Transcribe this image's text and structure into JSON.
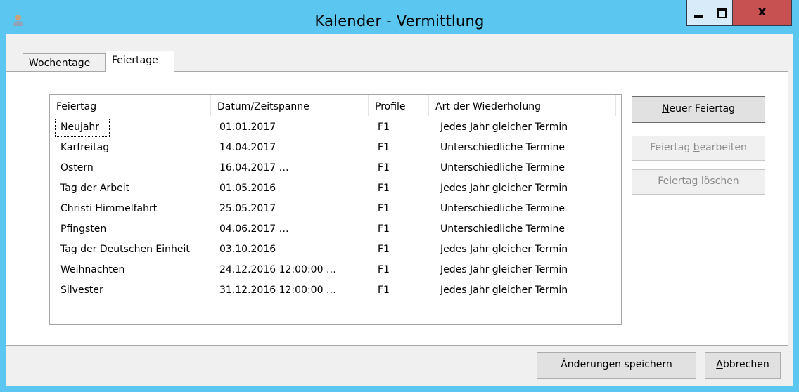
{
  "window": {
    "title": "Kalender - Vermittlung",
    "close_glyph": "x"
  },
  "tabs": [
    {
      "label": "Wochentage",
      "selected": false
    },
    {
      "label": "Feiertage",
      "selected": true
    }
  ],
  "list": {
    "columns": [
      "Feiertag",
      "Datum/Zeitspanne",
      "Profile",
      "Art der Wiederholung"
    ],
    "rows": [
      {
        "name": "Neujahr",
        "date": "01.01.2017",
        "profile": "F1",
        "repeat": "Jedes Jahr gleicher Termin"
      },
      {
        "name": "Karfreitag",
        "date": "14.04.2017",
        "profile": "F1",
        "repeat": "Unterschiedliche Termine"
      },
      {
        "name": "Ostern",
        "date": "16.04.2017 …",
        "profile": "F1",
        "repeat": "Unterschiedliche Termine"
      },
      {
        "name": "Tag der Arbeit",
        "date": "01.05.2016",
        "profile": "F1",
        "repeat": "Jedes Jahr gleicher Termin"
      },
      {
        "name": "Christi Himmelfahrt",
        "date": "25.05.2017",
        "profile": "F1",
        "repeat": "Unterschiedliche Termine"
      },
      {
        "name": "Pfingsten",
        "date": "04.06.2017 …",
        "profile": "F1",
        "repeat": "Unterschiedliche Termine"
      },
      {
        "name": "Tag der Deutschen Einheit",
        "date": "03.10.2016",
        "profile": "F1",
        "repeat": "Jedes Jahr gleicher Termin"
      },
      {
        "name": "Weihnachten",
        "date": "24.12.2016 12:00:00 …",
        "profile": "F1",
        "repeat": "Jedes Jahr gleicher Termin"
      },
      {
        "name": "Silvester",
        "date": "31.12.2016 12:00:00 …",
        "profile": "F1",
        "repeat": "Jedes Jahr gleicher Termin"
      }
    ]
  },
  "side_buttons": {
    "new": {
      "pre": "",
      "accel": "N",
      "post": "euer Feiertag"
    },
    "edit": {
      "pre": "Feiertag ",
      "accel": "b",
      "post": "earbeiten"
    },
    "delete": {
      "pre": "Feiertag ",
      "accel": "l",
      "post": "öschen"
    }
  },
  "footer": {
    "save": "Änderungen speichern",
    "cancel": {
      "accel": "A",
      "post": "bbrechen"
    }
  },
  "colors": {
    "titlebar": "#5bc6ef",
    "close_button": "#c75050"
  }
}
